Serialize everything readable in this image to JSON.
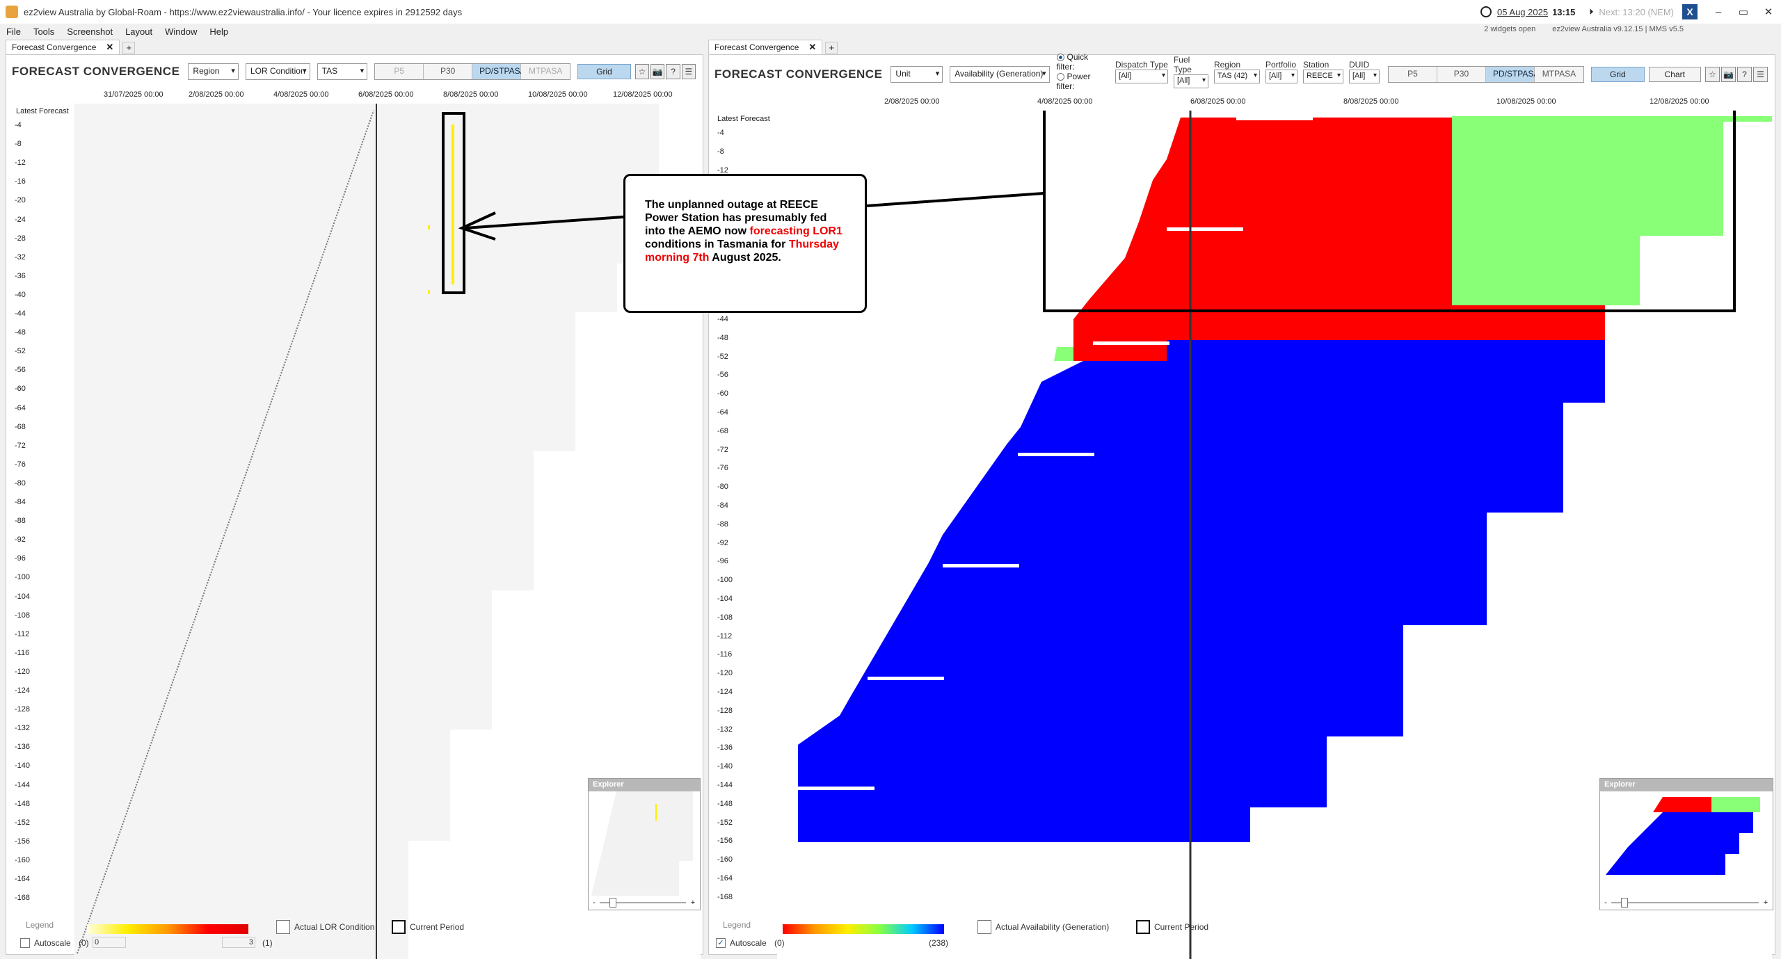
{
  "app": {
    "title": "ez2view Australia by Global-Roam - https://www.ez2viewaustralia.info/ - Your licence expires in 2912592 days",
    "date": "05 Aug 2025",
    "time": "13:15",
    "next": "Next: 13:20 (NEM)",
    "widgets_open": "2 widgets open",
    "version": "ez2view Australia v9.12.15 | MMS v5.5",
    "x_logo": "X",
    "window_buttons": [
      "–",
      "▭",
      "✕"
    ]
  },
  "menu": [
    "File",
    "Tools",
    "Screenshot",
    "Layout",
    "Window",
    "Help"
  ],
  "left": {
    "tab_label": "Forecast Convergence",
    "tab_close": "✕",
    "tab_add": "+",
    "title": "FORECAST CONVERGENCE",
    "dropdowns": [
      "Region",
      "LOR Condition",
      "TAS"
    ],
    "seg_buttons": [
      "P5",
      "P30",
      "PD/STPASA",
      "MTPASA"
    ],
    "grid_label": "Grid",
    "icons": [
      "☆",
      "📷",
      "?",
      "☰"
    ],
    "x_ticks": [
      "31/07/2025 00:00",
      "2/08/2025 00:00",
      "4/08/2025 00:00",
      "6/08/2025 00:00",
      "8/08/2025 00:00",
      "10/08/2025 00:00",
      "12/08/2025 00:00"
    ],
    "y_header": "Latest Forecast",
    "legend_label": "Legend",
    "legend_items": [
      "Actual LOR Condition",
      "Current Period"
    ],
    "autoscale_label": "Autoscale",
    "range_min_label": "(0)",
    "range_min_value": "0",
    "range_max_value": "3",
    "range_max_label": "(1)",
    "explorer_label": "Explorer",
    "scroll_left": "-",
    "scroll_right": "+"
  },
  "right": {
    "tab_label": "Forecast Convergence",
    "tab_close": "✕",
    "tab_add": "+",
    "title": "FORECAST CONVERGENCE",
    "dropdowns": [
      "Unit",
      "Availability (Generation)"
    ],
    "quick_filter": "Quick filter:",
    "power_filter": "Power filter:",
    "filters": [
      {
        "label": "Dispatch Type",
        "value": "[All]"
      },
      {
        "label": "Fuel Type",
        "value": "[All]"
      },
      {
        "label": "Region",
        "value": "TAS (42)"
      },
      {
        "label": "Portfolio",
        "value": "[All]"
      },
      {
        "label": "Station",
        "value": "REECE"
      },
      {
        "label": "DUID",
        "value": "[All]"
      }
    ],
    "seg_buttons": [
      "P5",
      "P30",
      "PD/STPASA",
      "MTPASA"
    ],
    "grid_label": "Grid",
    "chart_label": "Chart",
    "icons": [
      "☆",
      "📷",
      "?",
      "☰"
    ],
    "x_ticks": [
      "2/08/2025 00:00",
      "4/08/2025 00:00",
      "6/08/2025 00:00",
      "8/08/2025 00:00",
      "10/08/2025 00:00",
      "12/08/2025 00:00"
    ],
    "y_header": "Latest Forecast",
    "legend_label": "Legend",
    "legend_items": [
      "Actual Availability (Generation)",
      "Current Period"
    ],
    "autoscale_label": "Autoscale",
    "range_min_label": "(0)",
    "range_max_label": "(238)",
    "explorer_label": "Explorer",
    "scroll_left": "-",
    "scroll_right": "+"
  },
  "y_ticks": [
    "-4",
    "-8",
    "-12",
    "-16",
    "-20",
    "-24",
    "-28",
    "-32",
    "-36",
    "-40",
    "-44",
    "-48",
    "-52",
    "-56",
    "-60",
    "-64",
    "-68",
    "-72",
    "-76",
    "-80",
    "-84",
    "-88",
    "-92",
    "-96",
    "-100",
    "-104",
    "-108",
    "-112",
    "-116",
    "-120",
    "-124",
    "-128",
    "-132",
    "-136",
    "-140",
    "-144",
    "-148",
    "-152",
    "-156",
    "-160",
    "-164",
    "-168"
  ],
  "callout": {
    "part1": "The unplanned outage at REECE Power Station has presumably fed into the AEMO now ",
    "part2": "forecasting LOR1",
    "part3": " conditions in Tasmania for ",
    "part4": "Thursday morning 7th",
    "part5": " August 2025."
  },
  "colors": {
    "red": "#ff0000",
    "green": "#88ff77",
    "blue": "#0000ff",
    "yellow": "#ffee00",
    "accent": "#bcd8ef"
  }
}
